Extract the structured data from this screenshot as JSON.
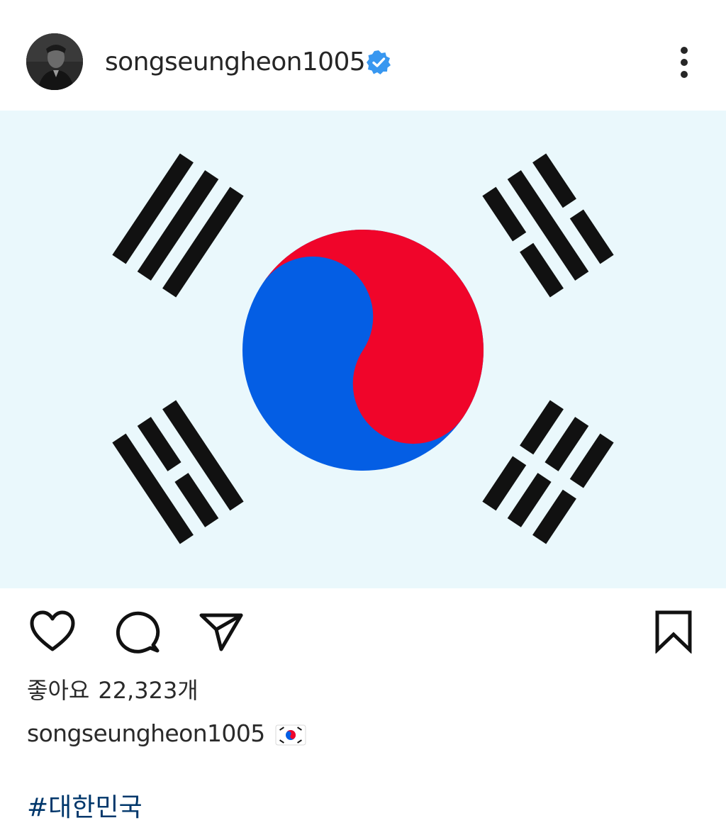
{
  "post": {
    "username": "songseungheon1005",
    "verified_icon": "verified-badge-icon",
    "more_icon": "more-vertical-icon",
    "image_subject": "Flag of South Korea (Taegukgi)",
    "colors": {
      "flag_background": "#eaf8fc",
      "taeguk_red": "#f0052a",
      "taeguk_blue": "#045ee4",
      "trigram_black": "#111111",
      "verified_blue": "#3897f0",
      "hashtag": "#00376b"
    },
    "actions": {
      "like_icon": "heart-icon",
      "comment_icon": "comment-icon",
      "share_icon": "send-icon",
      "save_icon": "bookmark-icon"
    },
    "likes_label": "좋아요",
    "likes_count": "22,323개",
    "caption_username": "songseungheon1005",
    "caption_emoji": "🇰🇷",
    "hashtag": "#대한민국"
  }
}
